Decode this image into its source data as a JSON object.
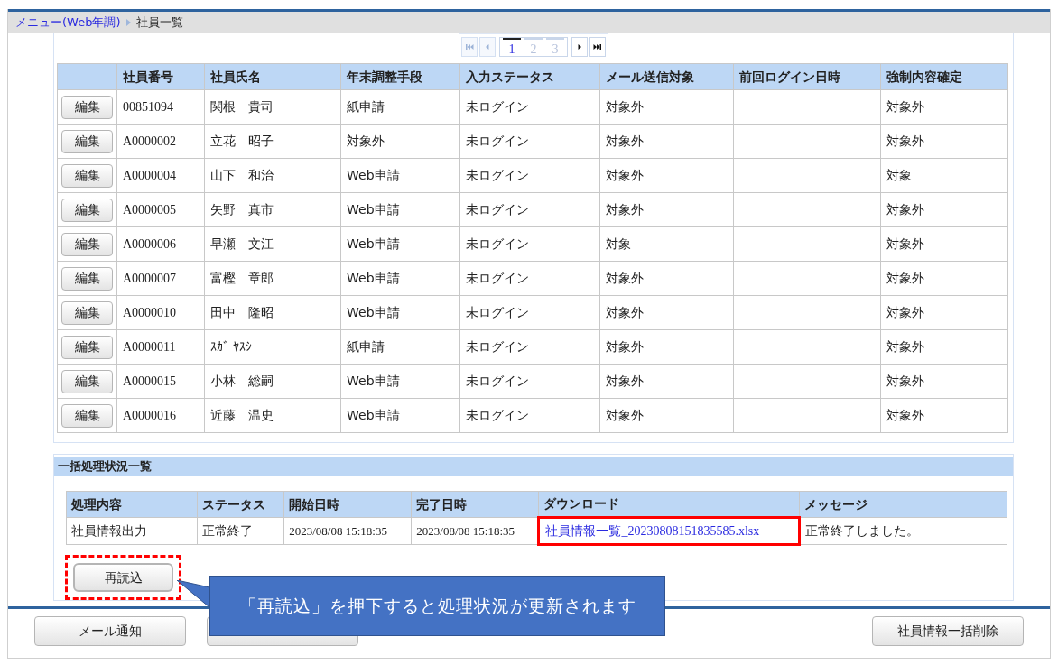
{
  "breadcrumb": {
    "link": "メニュー(Web年調)",
    "current": "社員一覧"
  },
  "pager": {
    "nav": [
      {
        "kind": "first",
        "disabled": true
      },
      {
        "kind": "prev",
        "disabled": true
      },
      {
        "kind": "next",
        "disabled": false
      },
      {
        "kind": "last",
        "disabled": false
      }
    ],
    "pages": [
      {
        "label": "1",
        "selected": true
      },
      {
        "label": "2",
        "selected": false
      },
      {
        "label": "3",
        "selected": false
      }
    ]
  },
  "employees": {
    "columns": [
      "",
      "社員番号",
      "社員氏名",
      "年末調整手段",
      "入力ステータス",
      "メール送信対象",
      "前回ログイン日時",
      "強制内容確定"
    ],
    "rows": [
      {
        "button": "編集",
        "id": "00851094",
        "name": "関根　貴司",
        "method": "紙申請",
        "status": "未ログイン",
        "mail": "対象外",
        "force": "対象外"
      },
      {
        "button": "編集",
        "id": "A0000002",
        "name": "立花　昭子",
        "method": "対象外",
        "status": "未ログイン",
        "mail": "対象外",
        "force": "対象外"
      },
      {
        "button": "編集",
        "id": "A0000004",
        "name": "山下　和治",
        "method": "Web申請",
        "status": "未ログイン",
        "mail": "対象外",
        "force": "対象"
      },
      {
        "button": "編集",
        "id": "A0000005",
        "name": "矢野　真市",
        "method": "Web申請",
        "status": "未ログイン",
        "mail": "対象外",
        "force": "対象外"
      },
      {
        "button": "編集",
        "id": "A0000006",
        "name": "早瀬　文江",
        "method": "Web申請",
        "status": "未ログイン",
        "mail": "対象",
        "force": "対象外"
      },
      {
        "button": "編集",
        "id": "A0000007",
        "name": "富樫　章郎",
        "method": "Web申請",
        "status": "未ログイン",
        "mail": "対象外",
        "force": "対象外"
      },
      {
        "button": "編集",
        "id": "A0000010",
        "name": "田中　隆昭",
        "method": "Web申請",
        "status": "未ログイン",
        "mail": "対象外",
        "force": "対象外"
      },
      {
        "button": "編集",
        "id": "A0000011",
        "name": "ｽｶﾞ ﾔｽｼ",
        "method": "紙申請",
        "status": "未ログイン",
        "mail": "対象外",
        "force": "対象外"
      },
      {
        "button": "編集",
        "id": "A0000015",
        "name": "小林　総嗣",
        "method": "Web申請",
        "status": "未ログイン",
        "mail": "対象外",
        "force": "対象外"
      },
      {
        "button": "編集",
        "id": "A0000016",
        "name": "近藤　温史",
        "method": "Web申請",
        "status": "未ログイン",
        "mail": "対象外",
        "force": "対象外"
      }
    ]
  },
  "batch": {
    "title": "一括処理状況一覧",
    "columns": [
      "処理内容",
      "ステータス",
      "開始日時",
      "完了日時",
      "ダウンロード",
      "メッセージ"
    ],
    "rows": [
      {
        "process": "社員情報出力",
        "status": "正常終了",
        "start": "2023/08/08 15:18:35",
        "end": "2023/08/08 15:18:35",
        "download": "社員情報一覧_20230808151835585.xlsx",
        "download_highlighted": true,
        "message": "正常終了しました。"
      }
    ],
    "reload_button": {
      "label": "再読込",
      "highlighted": true
    }
  },
  "callout": {
    "text": "「再読込」を押下すると処理状況が更新されます"
  },
  "footer": {
    "left_buttons": [
      {
        "label": "メール通知"
      }
    ],
    "right_buttons": [
      {
        "label": "社員情報一括削除"
      }
    ]
  }
}
